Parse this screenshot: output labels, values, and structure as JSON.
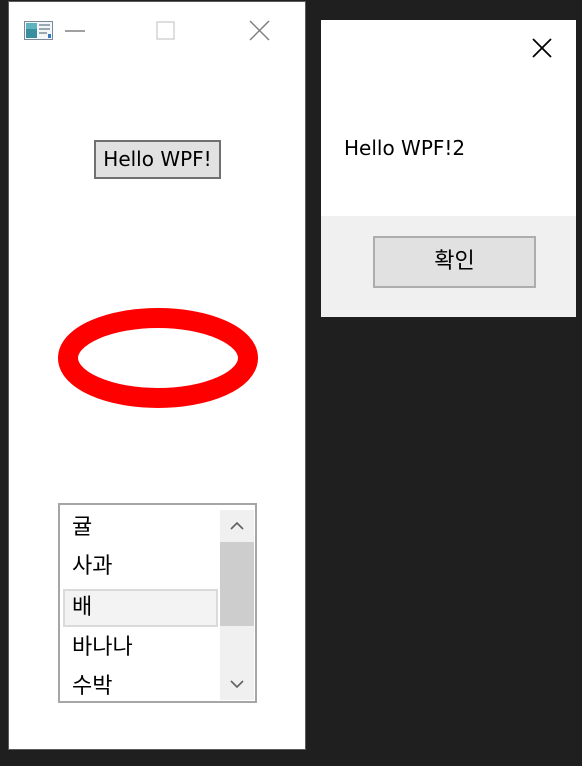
{
  "main_window": {
    "icon": "app-window-icon",
    "caption_buttons": [
      "minimize-icon",
      "maximize-icon",
      "close-icon"
    ],
    "hello_button_label": "Hello WPF!",
    "ellipse_color": "#ff0000",
    "listbox": {
      "items": [
        {
          "label": "귤"
        },
        {
          "label": "사과"
        },
        {
          "label": "배"
        },
        {
          "label": "바나나"
        },
        {
          "label": "수박"
        }
      ],
      "selected_item": "배"
    }
  },
  "message_box": {
    "message": "Hello WPF!2",
    "ok_label": "확인",
    "close_icon": "close-icon"
  }
}
